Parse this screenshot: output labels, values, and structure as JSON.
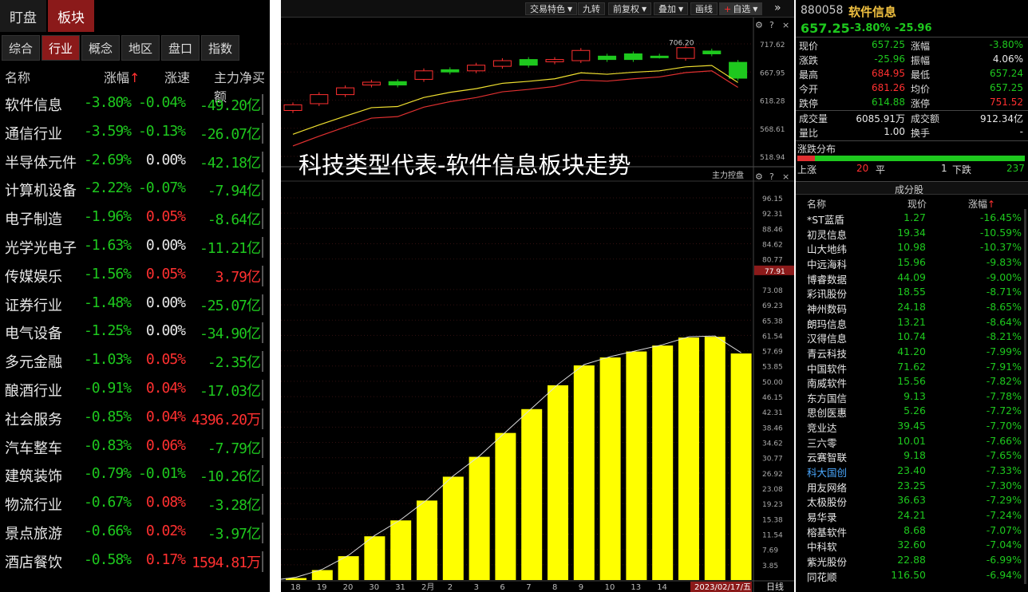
{
  "left": {
    "top_tabs": [
      "盯盘",
      "板块"
    ],
    "sub_tabs": [
      "综合",
      "行业",
      "概念",
      "地区",
      "盘口",
      "指数"
    ],
    "headers": {
      "name": "名称",
      "pct": "涨幅",
      "pct_arrow": "↑",
      "speed": "涨速",
      "flow": "主力净买额"
    },
    "rows": [
      {
        "name": "软件信息",
        "pct": "-3.80%",
        "speed": "-0.04%",
        "flow": "-49.20亿",
        "speed_color": "g",
        "flow_color": "g"
      },
      {
        "name": "通信行业",
        "pct": "-3.59%",
        "speed": "-0.13%",
        "flow": "-26.07亿",
        "speed_color": "g",
        "flow_color": "g"
      },
      {
        "name": "半导体元件",
        "pct": "-2.69%",
        "speed": "0.00%",
        "flow": "-42.18亿",
        "speed_color": "w",
        "flow_color": "g"
      },
      {
        "name": "计算机设备",
        "pct": "-2.22%",
        "speed": "-0.07%",
        "flow": "-7.94亿",
        "speed_color": "g",
        "flow_color": "g"
      },
      {
        "name": "电子制造",
        "pct": "-1.96%",
        "speed": "0.05%",
        "flow": "-8.64亿",
        "speed_color": "r",
        "flow_color": "g"
      },
      {
        "name": "光学光电子",
        "pct": "-1.63%",
        "speed": "0.00%",
        "flow": "-11.21亿",
        "speed_color": "w",
        "flow_color": "g"
      },
      {
        "name": "传媒娱乐",
        "pct": "-1.56%",
        "speed": "0.05%",
        "flow": "3.79亿",
        "speed_color": "r",
        "flow_color": "r"
      },
      {
        "name": "证券行业",
        "pct": "-1.48%",
        "speed": "0.00%",
        "flow": "-25.07亿",
        "speed_color": "w",
        "flow_color": "g"
      },
      {
        "name": "电气设备",
        "pct": "-1.25%",
        "speed": "0.00%",
        "flow": "-34.90亿",
        "speed_color": "w",
        "flow_color": "g"
      },
      {
        "name": "多元金融",
        "pct": "-1.03%",
        "speed": "0.05%",
        "flow": "-2.35亿",
        "speed_color": "r",
        "flow_color": "g"
      },
      {
        "name": "酿酒行业",
        "pct": "-0.91%",
        "speed": "0.04%",
        "flow": "-17.03亿",
        "speed_color": "r",
        "flow_color": "g"
      },
      {
        "name": "社会服务",
        "pct": "-0.85%",
        "speed": "0.04%",
        "flow": "4396.20万",
        "speed_color": "r",
        "flow_color": "r"
      },
      {
        "name": "汽车整车",
        "pct": "-0.83%",
        "speed": "0.06%",
        "flow": "-7.79亿",
        "speed_color": "r",
        "flow_color": "g"
      },
      {
        "name": "建筑装饰",
        "pct": "-0.79%",
        "speed": "-0.01%",
        "flow": "-10.26亿",
        "speed_color": "g",
        "flow_color": "g"
      },
      {
        "name": "物流行业",
        "pct": "-0.67%",
        "speed": "0.08%",
        "flow": "-3.28亿",
        "speed_color": "r",
        "flow_color": "g"
      },
      {
        "name": "景点旅游",
        "pct": "-0.66%",
        "speed": "0.02%",
        "flow": "-3.97亿",
        "speed_color": "r",
        "flow_color": "g"
      },
      {
        "name": "酒店餐饮",
        "pct": "-0.58%",
        "speed": "0.17%",
        "flow": "1594.81万",
        "speed_color": "r",
        "flow_color": "r"
      }
    ]
  },
  "toolbar": [
    "交易特色",
    "九转",
    "前复权",
    "叠加",
    "画线",
    "自选"
  ],
  "overlay_title": "科技类型代表-软件信息板块走势",
  "kline": {
    "y_ticks": [
      "717.62",
      "667.95",
      "618.28",
      "568.61",
      "518.94"
    ],
    "high_label": "706.20",
    "candles": [
      [
        600,
        610
      ],
      [
        612,
        628
      ],
      [
        628,
        640
      ],
      [
        645,
        650
      ],
      [
        645,
        651
      ],
      [
        655,
        670
      ],
      [
        668,
        672
      ],
      [
        670,
        680
      ],
      [
        678,
        688
      ],
      [
        680,
        690
      ],
      [
        686,
        690
      ],
      [
        688,
        706
      ],
      [
        690,
        696
      ],
      [
        690,
        700
      ],
      [
        696,
        696
      ],
      [
        692,
        711
      ],
      [
        705,
        700
      ],
      [
        685,
        657
      ]
    ],
    "candle_colors": [
      "r",
      "r",
      "r",
      "r",
      "g",
      "r",
      "g",
      "r",
      "r",
      "g",
      "r",
      "r",
      "g",
      "g",
      "g",
      "r",
      "g",
      "g"
    ]
  },
  "flow_chart": {
    "label": "主力控盘",
    "current": "77.91",
    "y_ticks": [
      "96.15",
      "92.31",
      "88.46",
      "84.62",
      "80.77",
      "73.08",
      "69.23",
      "65.38",
      "61.54",
      "57.69",
      "53.85",
      "50.00",
      "46.15",
      "42.31",
      "38.46",
      "34.62",
      "30.77",
      "26.92",
      "23.08",
      "19.23",
      "15.38",
      "11.54",
      "7.69",
      "3.85"
    ],
    "values": [
      0.5,
      2.5,
      6,
      11,
      15,
      20,
      26,
      31,
      37,
      43,
      49,
      54,
      56,
      57.5,
      59,
      61,
      61.2,
      57
    ],
    "x_labels": [
      "18",
      "19",
      "20",
      "30",
      "31",
      "2月",
      "2",
      "3",
      "6",
      "7",
      "8",
      "9",
      "10",
      "13",
      "14"
    ],
    "date_badge": "2023/02/17/五",
    "daily_tab": "日线"
  },
  "quote": {
    "code": "880058",
    "name": "软件信息",
    "price": "657.25",
    "chg_pct": "-3.80%",
    "chg": "-25.96",
    "fields": [
      [
        "现价",
        "657.25",
        "涨幅",
        "-3.80%"
      ],
      [
        "涨跌",
        "-25.96",
        "振幅",
        "4.06%"
      ],
      [
        "最高",
        "684.95",
        "最低",
        "657.24"
      ],
      [
        "今开",
        "681.26",
        "均价",
        "657.25"
      ],
      [
        "跌停",
        "614.88",
        "涨停",
        "751.52"
      ]
    ],
    "field_colors": [
      [
        "g",
        "g"
      ],
      [
        "g",
        "w"
      ],
      [
        "r",
        "g"
      ],
      [
        "r",
        "g"
      ],
      [
        "g",
        "r"
      ]
    ],
    "vol": [
      [
        "成交量",
        "6085.91万",
        "成交额",
        "912.34亿"
      ],
      [
        "量比",
        "1.00",
        "换手",
        "-"
      ]
    ],
    "dist": {
      "title": "涨跌分布",
      "up_label": "上涨",
      "up": "20",
      "flat_label": "平",
      "flat": "1",
      "down_label": "下跌",
      "down": "237"
    },
    "constituents_title": "成分股",
    "cols": {
      "name": "名称",
      "price": "现价",
      "pct": "涨幅",
      "arrow": "↑"
    },
    "stocks": [
      [
        "*ST蓝盾",
        "1.27",
        "-16.45%"
      ],
      [
        "初灵信息",
        "19.34",
        "-10.59%"
      ],
      [
        "山大地纬",
        "10.98",
        "-10.37%"
      ],
      [
        "中远海科",
        "15.96",
        "-9.83%"
      ],
      [
        "博睿数据",
        "44.09",
        "-9.00%"
      ],
      [
        "彩讯股份",
        "18.55",
        "-8.71%"
      ],
      [
        "神州数码",
        "24.18",
        "-8.65%"
      ],
      [
        "朗玛信息",
        "13.21",
        "-8.64%"
      ],
      [
        "汉得信息",
        "10.74",
        "-8.21%"
      ],
      [
        "青云科技",
        "41.20",
        "-7.99%"
      ],
      [
        "中国软件",
        "71.62",
        "-7.91%"
      ],
      [
        "南威软件",
        "15.56",
        "-7.82%"
      ],
      [
        "东方国信",
        "9.13",
        "-7.78%"
      ],
      [
        "思创医惠",
        "5.26",
        "-7.72%"
      ],
      [
        "竞业达",
        "39.45",
        "-7.70%"
      ],
      [
        "三六零",
        "10.01",
        "-7.66%"
      ],
      [
        "云赛智联",
        "9.18",
        "-7.65%"
      ],
      [
        "科大国创",
        "23.40",
        "-7.33%"
      ],
      [
        "用友网络",
        "23.25",
        "-7.30%"
      ],
      [
        "太极股份",
        "36.63",
        "-7.29%"
      ],
      [
        "易华录",
        "24.21",
        "-7.24%"
      ],
      [
        "榕基软件",
        "8.68",
        "-7.07%"
      ],
      [
        "中科软",
        "32.60",
        "-7.04%"
      ],
      [
        "紫光股份",
        "22.88",
        "-6.99%"
      ],
      [
        "同花顺",
        "116.50",
        "-6.94%"
      ]
    ]
  }
}
